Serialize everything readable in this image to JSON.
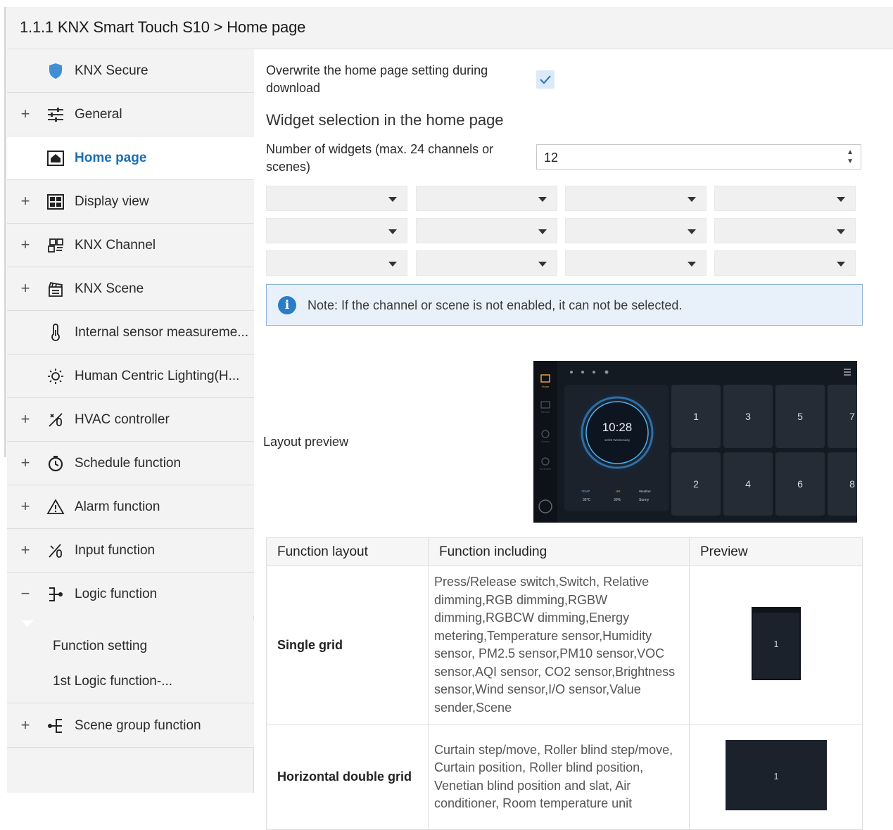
{
  "header": {
    "title": "1.1.1 KNX Smart Touch S10 > Home page"
  },
  "sidebar": {
    "items": [
      {
        "label": "KNX Secure",
        "expander": "",
        "icon": "shield-icon"
      },
      {
        "label": "General",
        "expander": "+",
        "icon": "sliders-icon"
      },
      {
        "label": "Home page",
        "expander": "",
        "icon": "home-icon"
      },
      {
        "label": "Display view",
        "expander": "+",
        "icon": "display-grid-icon"
      },
      {
        "label": "KNX Channel",
        "expander": "+",
        "icon": "channel-icon"
      },
      {
        "label": "KNX Scene",
        "expander": "+",
        "icon": "scene-icon"
      },
      {
        "label": "Internal sensor measureme...",
        "expander": "",
        "icon": "thermometer-icon"
      },
      {
        "label": "Human Centric Lighting(H...",
        "expander": "",
        "icon": "sun-icon"
      },
      {
        "label": "HVAC controller",
        "expander": "+",
        "icon": "hvac-icon"
      },
      {
        "label": "Schedule function",
        "expander": "+",
        "icon": "clock-icon"
      },
      {
        "label": "Alarm function",
        "expander": "+",
        "icon": "warning-icon"
      },
      {
        "label": "Input function",
        "expander": "+",
        "icon": "input-icon"
      },
      {
        "label": "Logic function",
        "expander": "−",
        "icon": "logic-icon"
      },
      {
        "label": "Scene group function",
        "expander": "+",
        "icon": "scene-group-icon"
      }
    ],
    "logic_subitems": [
      "Function setting",
      "1st Logic function-..."
    ]
  },
  "main": {
    "overwrite_label": "Overwrite the home page setting during download",
    "overwrite_checked": true,
    "widget_heading": "Widget selection in the home page",
    "num_widgets_label": "Number of widgets (max. 24 channels or scenes)",
    "num_widgets_value": "12",
    "note": "Note: If the channel or scene is not enabled, it can not be selected.",
    "layout_preview_label": "Layout preview",
    "preview": {
      "time": "10:28",
      "date": "12/28 Wednesday",
      "tiles": [
        "1",
        "3",
        "5",
        "7",
        "2",
        "4",
        "6",
        "8"
      ],
      "weather": [
        {
          "label": "TEMP",
          "value": "35°C"
        },
        {
          "label": "HR",
          "value": "30%"
        },
        {
          "label": "Weather",
          "value": "Sunny"
        }
      ],
      "side_labels": [
        "Home",
        "Device",
        "Scene",
        "Schedule"
      ]
    },
    "table": {
      "headers": [
        "Function layout",
        "Function including",
        "Preview"
      ],
      "rows": [
        {
          "layout": "Single grid",
          "including": "Press/Release switch,Switch, Relative dimming,RGB dimming,RGBW dimming,RGBCW dimming,Energy metering,Temperature sensor,Humidity sensor, PM2.5 sensor,PM10 sensor,VOC sensor,AQI sensor, CO2 sensor,Brightness sensor,Wind sensor,I/O sensor,Value sender,Scene",
          "tile": "1"
        },
        {
          "layout": "Horizontal double grid",
          "including": "Curtain step/move, Roller blind step/move, Curtain position, Roller blind position, Venetian blind position and slat, Air conditioner, Room temperature unit",
          "tile": "1"
        }
      ]
    }
  },
  "colors": {
    "accent": "#1a6fb5",
    "note_bg": "#e8f1fa",
    "info_icon": "#2a7cc7"
  }
}
